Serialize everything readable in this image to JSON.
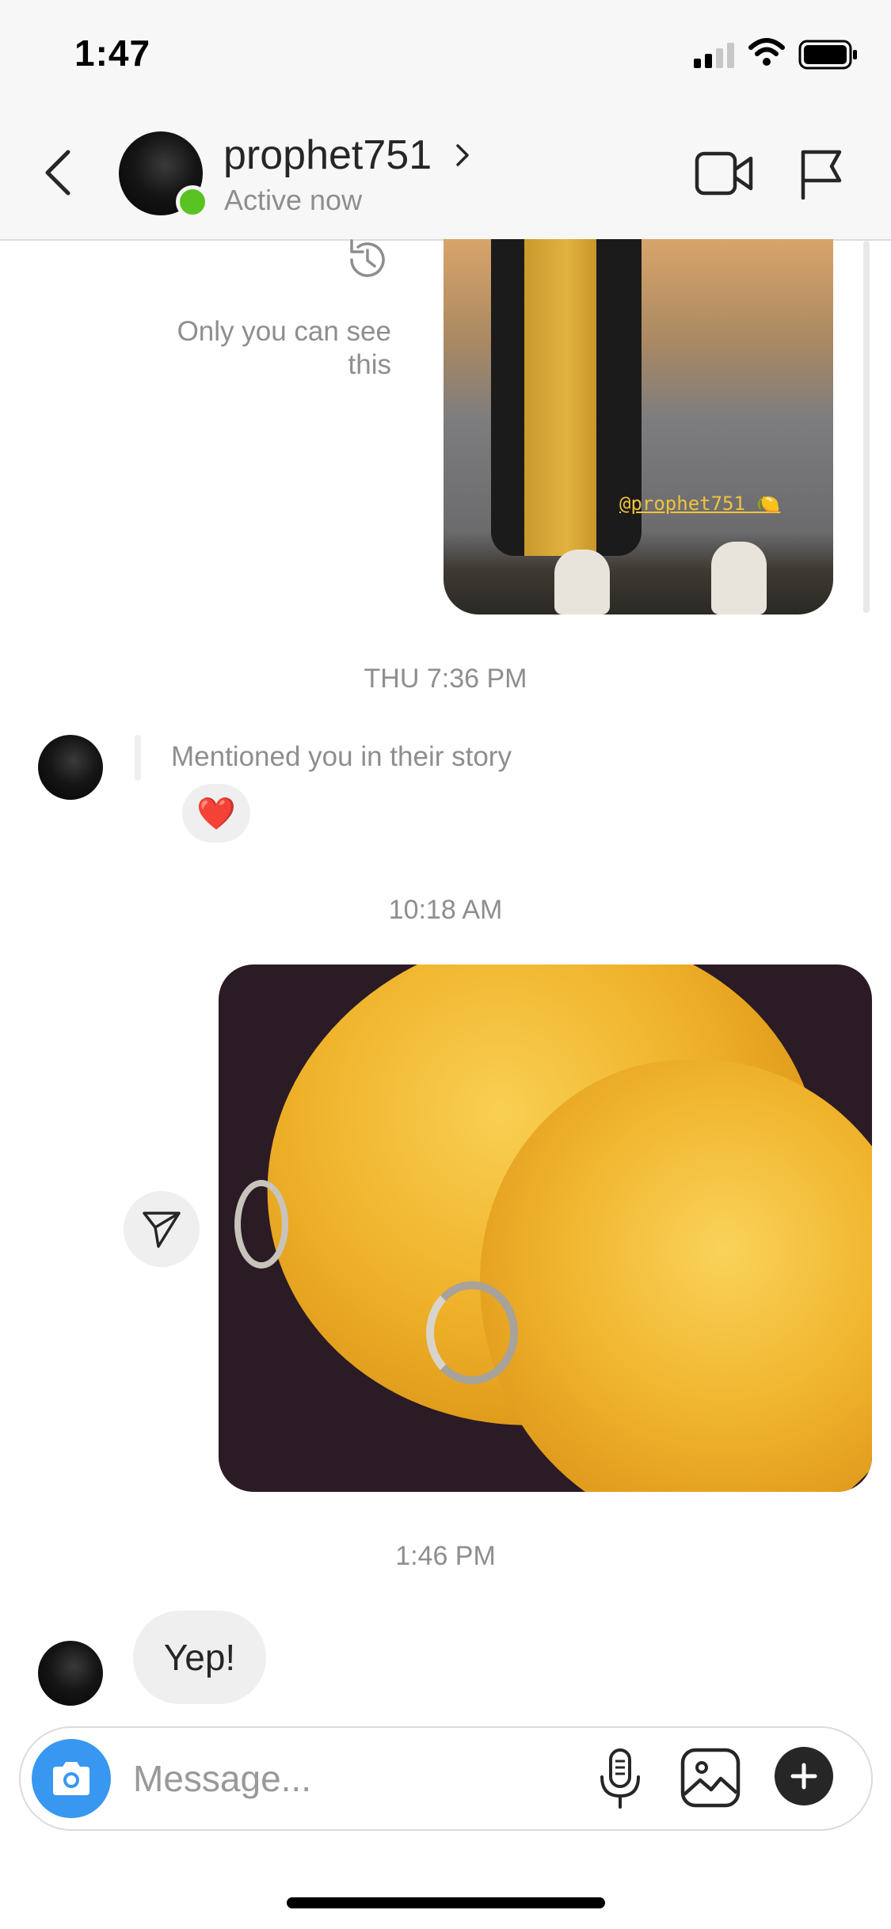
{
  "status_bar": {
    "time": "1:47",
    "icons": [
      "signal-icon",
      "wifi-icon",
      "battery-icon"
    ]
  },
  "header": {
    "username": "prophet751",
    "status": "Active now",
    "icons": [
      "back-chevron-icon",
      "chevron-right-icon",
      "video-call-icon",
      "flag-icon"
    ]
  },
  "thread": {
    "story_reply": {
      "note": "Only you can see this",
      "story_tag": "@prophet751 🍋"
    },
    "timestamp_1": "THU 7:36 PM",
    "mention": {
      "text": "Mentioned you in their story",
      "reaction": "❤️"
    },
    "timestamp_2": "10:18 AM",
    "timestamp_3": "1:46 PM",
    "reply": {
      "text": "Yep!"
    }
  },
  "composer": {
    "placeholder": "Message..."
  },
  "colors": {
    "online_dot": "#58c322",
    "camera_button": "#3897f0",
    "secondary_text": "#8e8e8e",
    "bubble": "#efefef",
    "text": "#262626"
  }
}
